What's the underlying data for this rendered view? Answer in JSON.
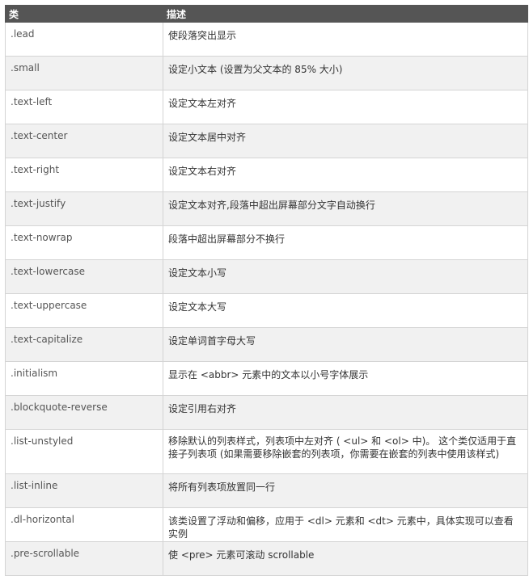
{
  "table": {
    "headers": [
      "类",
      "描述"
    ],
    "rows": [
      {
        "cls": ".lead",
        "desc": "使段落突出显示"
      },
      {
        "cls": ".small",
        "desc": "设定小文本 (设置为父文本的 85% 大小)"
      },
      {
        "cls": ".text-left",
        "desc": "设定文本左对齐"
      },
      {
        "cls": ".text-center",
        "desc": "设定文本居中对齐"
      },
      {
        "cls": ".text-right",
        "desc": "设定文本右对齐"
      },
      {
        "cls": ".text-justify",
        "desc": "设定文本对齐,段落中超出屏幕部分文字自动换行"
      },
      {
        "cls": ".text-nowrap",
        "desc": "段落中超出屏幕部分不换行"
      },
      {
        "cls": ".text-lowercase",
        "desc": "设定文本小写"
      },
      {
        "cls": ".text-uppercase",
        "desc": "设定文本大写"
      },
      {
        "cls": ".text-capitalize",
        "desc": "设定单词首字母大写"
      },
      {
        "cls": ".initialism",
        "desc": "显示在 <abbr> 元素中的文本以小号字体展示"
      },
      {
        "cls": ".blockquote-reverse",
        "desc": "设定引用右对齐"
      },
      {
        "cls": ".list-unstyled",
        "desc": "移除默认的列表样式，列表项中左对齐 ( <ul> 和 <ol> 中)。 这个类仅适用于直接子列表项 (如果需要移除嵌套的列表项，你需要在嵌套的列表中使用该样式)"
      },
      {
        "cls": ".list-inline",
        "desc": "将所有列表项放置同一行"
      },
      {
        "cls": ".dl-horizontal",
        "desc": "该类设置了浮动和偏移，应用于 <dl> 元素和 <dt> 元素中，具体实现可以查看实例"
      },
      {
        "cls": ".pre-scrollable",
        "desc": "使 <pre> 元素可滚动 scrollable"
      }
    ]
  }
}
